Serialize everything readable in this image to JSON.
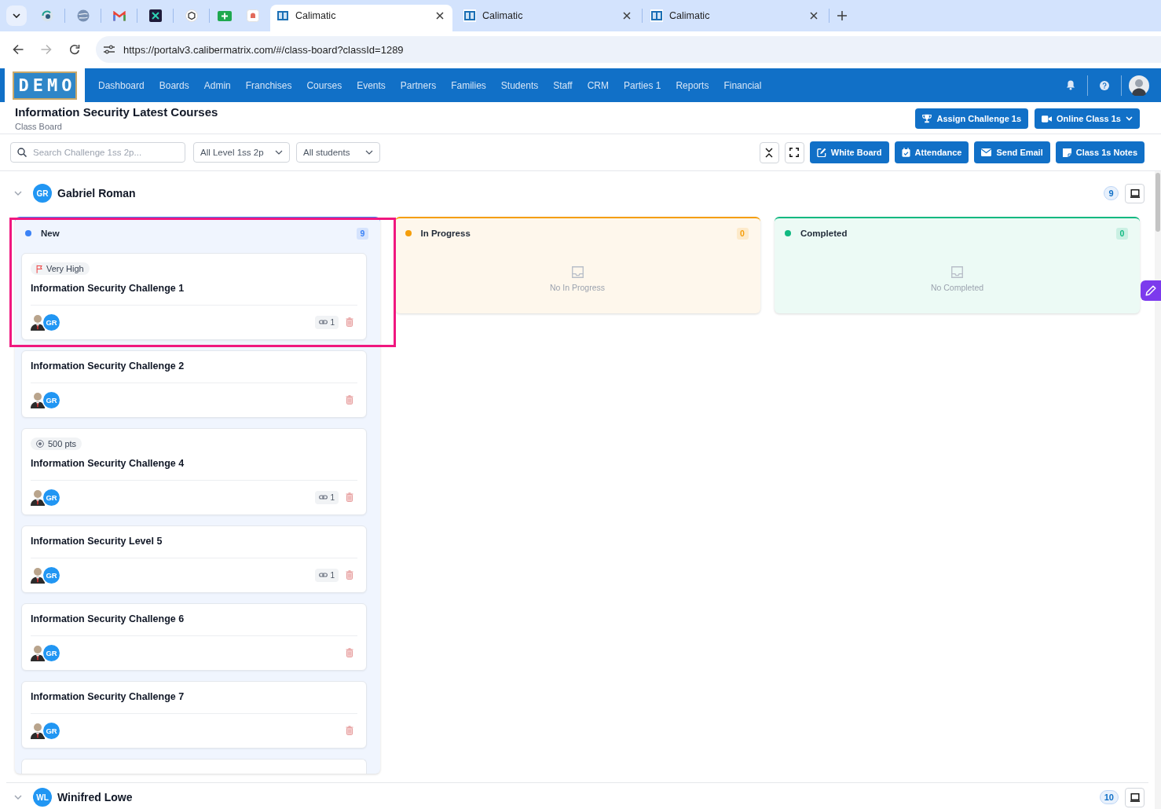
{
  "browser": {
    "tabs": [
      {
        "title": "Calimatic",
        "selected": true
      },
      {
        "title": "Calimatic",
        "selected": false
      },
      {
        "title": "Calimatic",
        "selected": false
      }
    ],
    "url": "https://portalv3.calibermatrix.com/#/class-board?classId=1289"
  },
  "app": {
    "logo": "DEMO",
    "nav": [
      "Dashboard",
      "Boards",
      "Admin",
      "Franchises",
      "Courses",
      "Events",
      "Partners",
      "Families",
      "Students",
      "Staff",
      "CRM",
      "Parties 1",
      "Reports",
      "Financial"
    ]
  },
  "header": {
    "title": "Information Security Latest Courses",
    "subtitle": "Class Board",
    "actions": [
      {
        "label": "Assign Challenge 1s",
        "dropdown": false
      },
      {
        "label": "Online Class 1s",
        "dropdown": true
      }
    ]
  },
  "toolbar": {
    "search": {
      "placeholder": "Search Challenge 1ss 2p..."
    },
    "filters": [
      "All Level 1ss 2p",
      "All students"
    ],
    "actions": [
      "White Board",
      "Attendance",
      "Send Email",
      "Class 1s Notes"
    ]
  },
  "groups": [
    {
      "initials": "GR",
      "name": "Gabriel Roman",
      "count": "9",
      "columns": [
        {
          "title": "New",
          "count": "9",
          "color": "#3b82f6",
          "more_below": true,
          "cards": [
            {
              "tag": {
                "kind": "priority",
                "text": "Very High"
              },
              "title": "Information Security Challenge 1",
              "assignee": "GR",
              "links": "1",
              "highlighted": true
            },
            {
              "title": "Information Security Challenge 2",
              "assignee": "GR",
              "highlighted": false
            },
            {
              "tag": {
                "kind": "points",
                "text": "500 pts"
              },
              "title": "Information Security Challenge 4",
              "assignee": "GR",
              "links": "1",
              "highlighted": false
            },
            {
              "title": "Information Security Level 5",
              "assignee": "GR",
              "links": "1",
              "highlighted": false
            },
            {
              "title": "Information Security Challenge 6",
              "assignee": "GR",
              "highlighted": false
            },
            {
              "title": "Information Security Challenge 7",
              "assignee": "GR",
              "highlighted": false
            }
          ]
        },
        {
          "title": "In Progress",
          "count": "0",
          "color": "#f59e0b",
          "more_below": false,
          "empty_text": "No In Progress"
        },
        {
          "title": "Completed",
          "count": "0",
          "color": "#10b981",
          "more_below": false,
          "empty_text": "No Completed"
        }
      ]
    },
    {
      "initials": "WL",
      "name": "Winifred Lowe",
      "count": "10"
    }
  ]
}
